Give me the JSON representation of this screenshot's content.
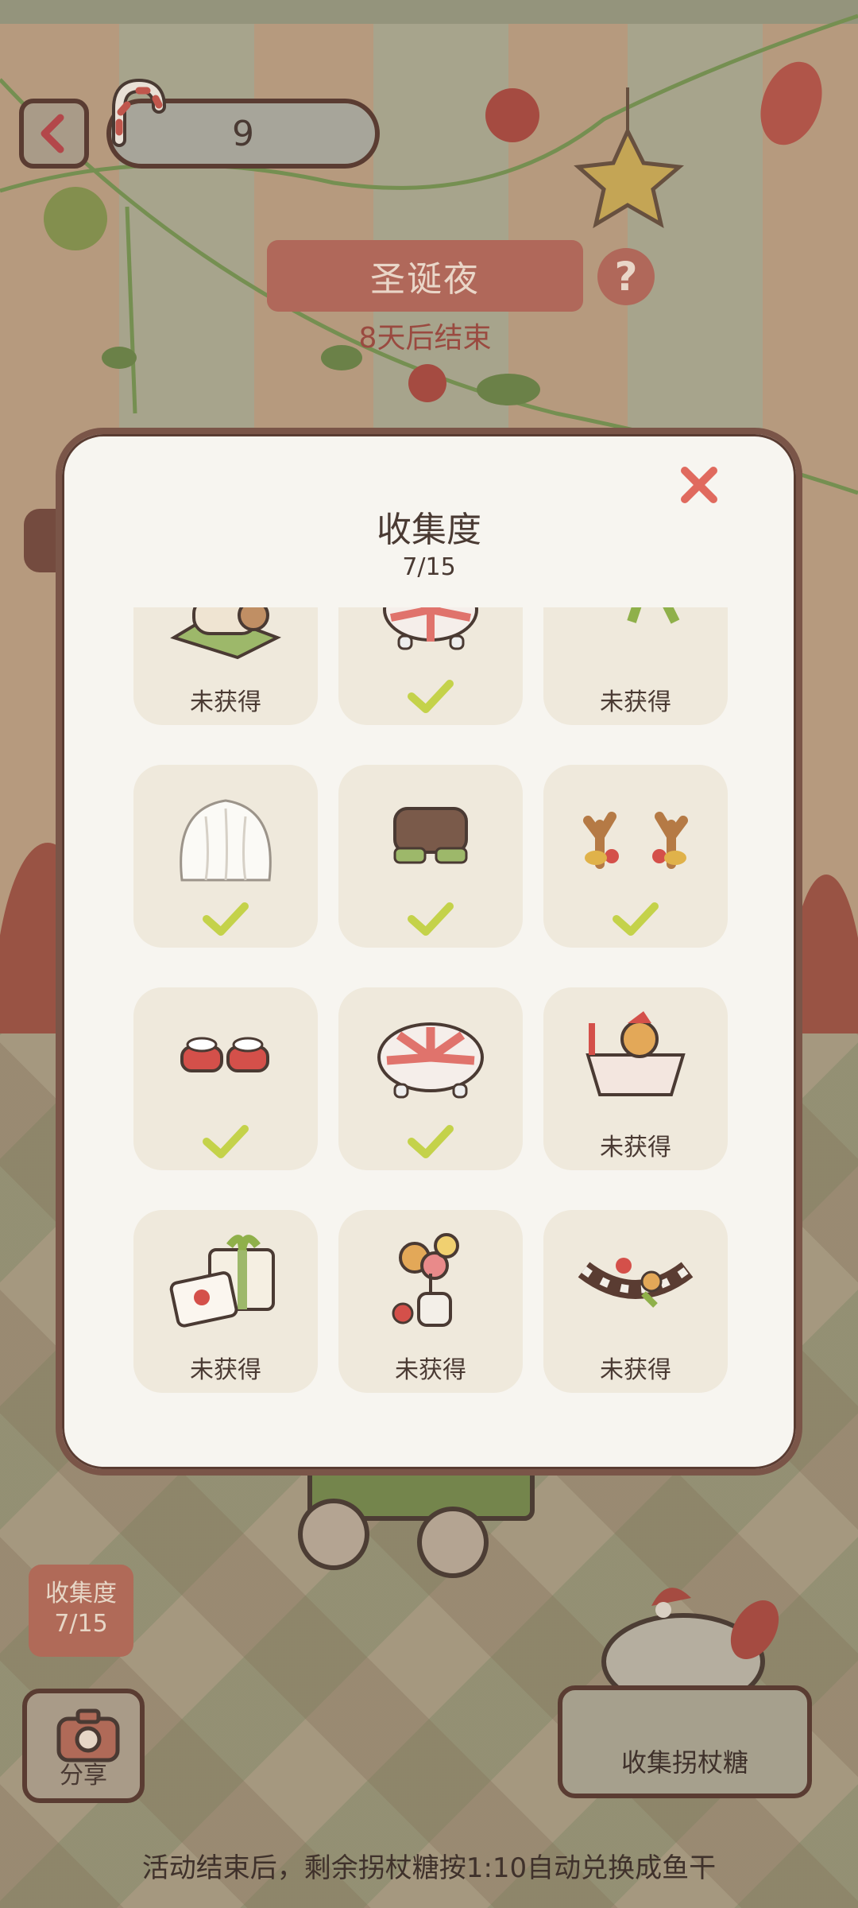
{
  "hud": {
    "back_icon": "chevron-left-icon",
    "candy_count": "9",
    "event_name": "圣诞夜",
    "help_label": "?",
    "event_timer": "8天后结束"
  },
  "modal": {
    "title": "收集度",
    "progress": "7/15",
    "close_icon": "close-icon",
    "items": [
      {
        "art": "yule-log-cake-icon",
        "status": "未获得",
        "obtained": false
      },
      {
        "art": "peppermint-stool-icon",
        "status": "",
        "obtained": true
      },
      {
        "art": "christmas-wreath-icon",
        "status": "未获得",
        "obtained": false
      },
      {
        "art": "white-wig-icon",
        "status": "",
        "obtained": true
      },
      {
        "art": "brown-shorts-icon",
        "status": "",
        "obtained": true
      },
      {
        "art": "reindeer-antlers-icon",
        "status": "",
        "obtained": true
      },
      {
        "art": "christmas-slippers-icon",
        "status": "",
        "obtained": true
      },
      {
        "art": "peppermint-cushion-icon",
        "status": "",
        "obtained": true
      },
      {
        "art": "gingerbread-sleigh-icon",
        "status": "未获得",
        "obtained": false
      },
      {
        "art": "gift-boxes-icon",
        "status": "未获得",
        "obtained": false
      },
      {
        "art": "lollipop-vase-icon",
        "status": "未获得",
        "obtained": false
      },
      {
        "art": "christmas-garland-icon",
        "status": "未获得",
        "obtained": false
      }
    ]
  },
  "bottom": {
    "badge_title": "收集度",
    "badge_progress": "7/15",
    "share_label": "分享",
    "collect_label": "收集拐杖糖",
    "footer_note": "活动结束后，剩余拐杖糖按1:10自动兑换成鱼干"
  },
  "colors": {
    "accent": "#b0685a",
    "outline": "#5a3c32",
    "check": "#c4d24a",
    "close": "#e06a5e"
  }
}
